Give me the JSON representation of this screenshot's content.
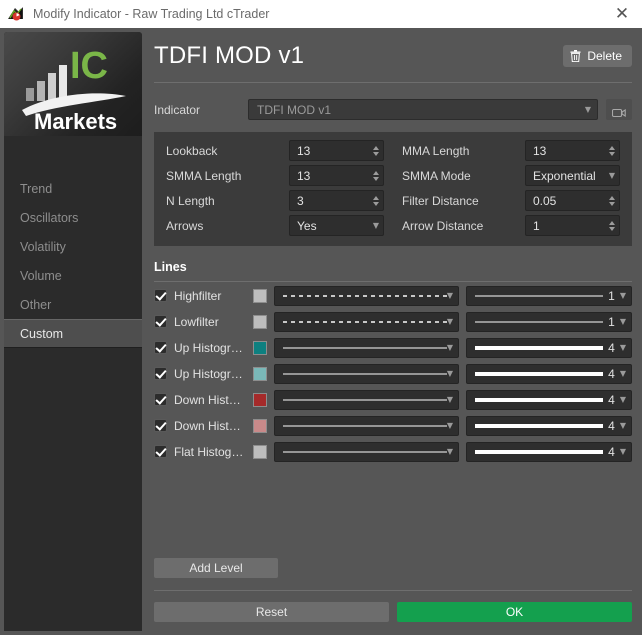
{
  "window": {
    "title": "Modify Indicator - Raw Trading Ltd cTrader",
    "app_icon": "ctrader-app-icon",
    "close_icon": "✕"
  },
  "sidebar": {
    "logo": {
      "brand_primary": "IC",
      "brand_secondary": "Markets",
      "accent_color": "#7ab648"
    },
    "items": [
      {
        "label": "Trend",
        "selected": false
      },
      {
        "label": "Oscillators",
        "selected": false
      },
      {
        "label": "Volatility",
        "selected": false
      },
      {
        "label": "Volume",
        "selected": false
      },
      {
        "label": "Other",
        "selected": false
      },
      {
        "label": "Custom",
        "selected": true
      }
    ]
  },
  "header": {
    "title": "TDFI MOD v1",
    "delete_label": "Delete",
    "delete_icon": "trash-icon"
  },
  "indicator": {
    "label": "Indicator",
    "value": "TDFI MOD v1",
    "caret": "▼",
    "camera_icon": "video-camera-icon"
  },
  "parameters": [
    {
      "label": "Lookback",
      "value": "13",
      "control": "spinner"
    },
    {
      "label": "MMA Length",
      "value": "13",
      "control": "spinner"
    },
    {
      "label": "SMMA Length",
      "value": "13",
      "control": "spinner"
    },
    {
      "label": "SMMA Mode",
      "value": "Exponential",
      "control": "dropdown"
    },
    {
      "label": "N Length",
      "value": "3",
      "control": "spinner"
    },
    {
      "label": "Filter Distance",
      "value": "0.05",
      "control": "spinner"
    },
    {
      "label": "Arrows",
      "value": "Yes",
      "control": "dropdown"
    },
    {
      "label": "Arrow Distance",
      "value": "1",
      "control": "spinner"
    }
  ],
  "lines": {
    "title": "Lines",
    "rows": [
      {
        "label": "Highfilter",
        "checked": true,
        "color": "#bdbdbd",
        "style": "dotted",
        "width": "1"
      },
      {
        "label": "Lowfilter",
        "checked": true,
        "color": "#bdbdbd",
        "style": "dotted",
        "width": "1"
      },
      {
        "label": "Up Histogra…",
        "checked": true,
        "color": "#0e8080",
        "style": "solid",
        "width": "4"
      },
      {
        "label": "Up Histogra…",
        "checked": true,
        "color": "#7ab8b8",
        "style": "solid",
        "width": "4"
      },
      {
        "label": "Down Histo…",
        "checked": true,
        "color": "#a52a2a",
        "style": "solid",
        "width": "4"
      },
      {
        "label": "Down Histo…",
        "checked": true,
        "color": "#c98a8a",
        "style": "solid",
        "width": "4"
      },
      {
        "label": "Flat Histogram",
        "checked": true,
        "color": "#bdbdbd",
        "style": "solid",
        "width": "4"
      }
    ]
  },
  "footer": {
    "add_level_label": "Add Level",
    "reset_label": "Reset",
    "ok_label": "OK",
    "ok_color": "#14a04e"
  }
}
